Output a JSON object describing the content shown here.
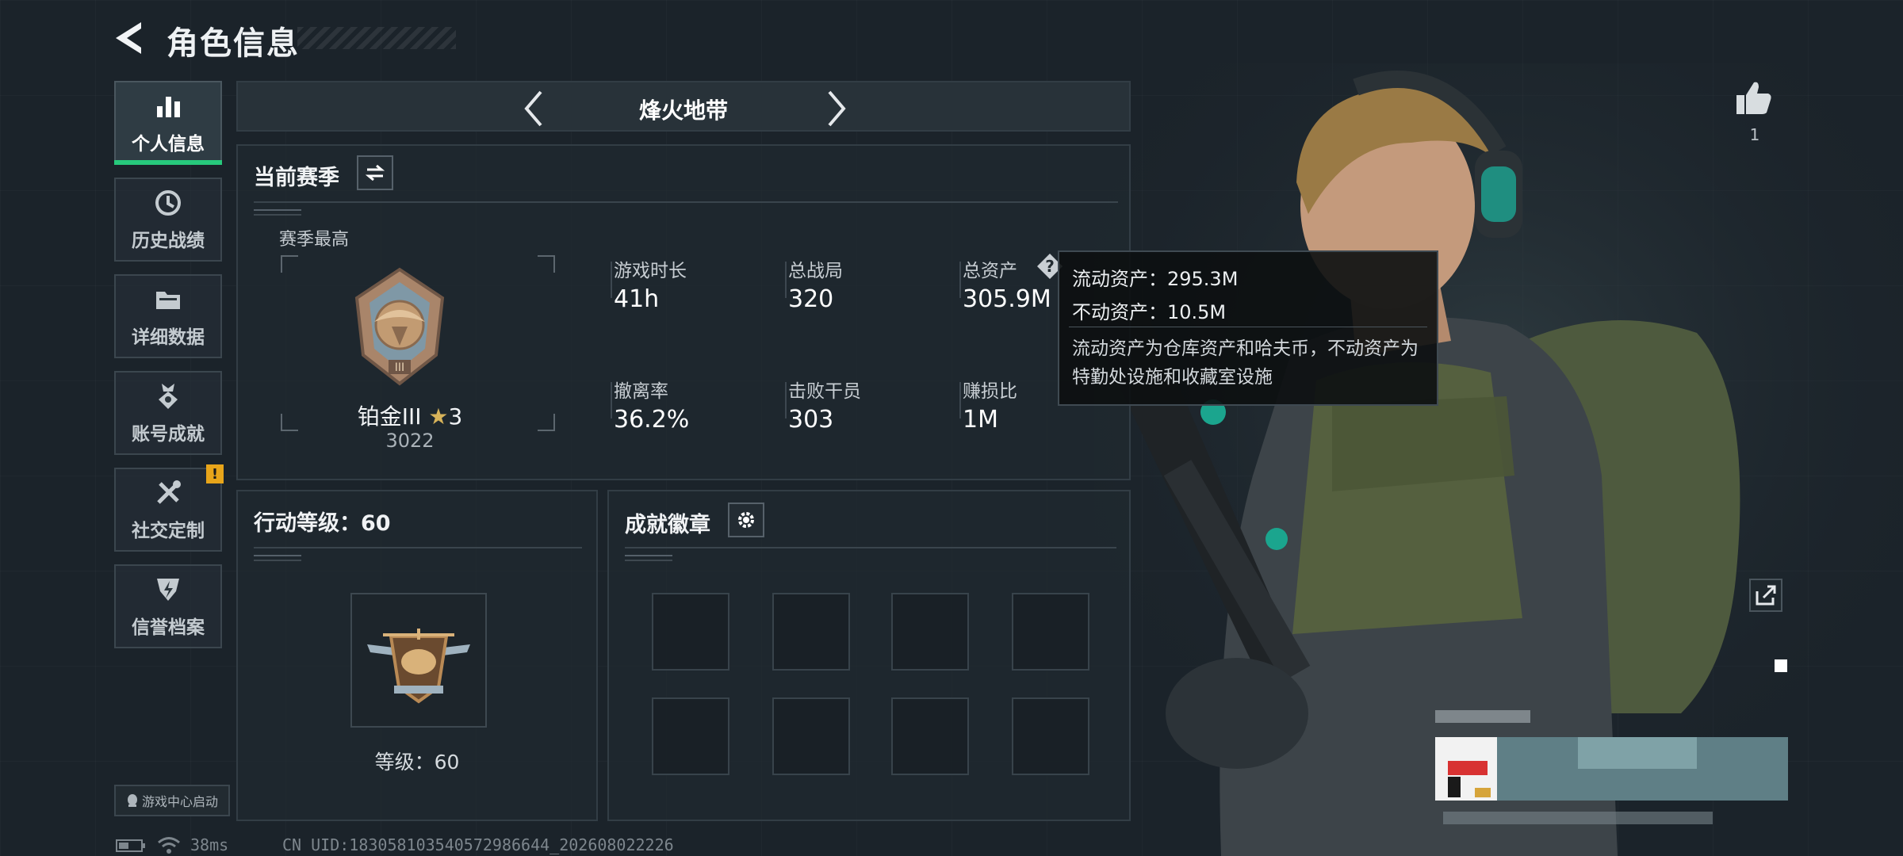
{
  "header": {
    "title": "角色信息"
  },
  "sidebar": {
    "items": [
      {
        "label": "个人信息",
        "icon": "bar-chart-icon",
        "active": true
      },
      {
        "label": "历史战绩",
        "icon": "history-clock-icon"
      },
      {
        "label": "详细数据",
        "icon": "folder-icon"
      },
      {
        "label": "账号成就",
        "icon": "medal-icon"
      },
      {
        "label": "社交定制",
        "icon": "tools-icon",
        "badge": "!"
      },
      {
        "label": "信誉档案",
        "icon": "credit-shield-icon"
      }
    ],
    "launch_label": "游戏中心启动"
  },
  "mode": {
    "title": "烽火地带"
  },
  "season": {
    "title": "当前赛季",
    "best_label": "赛季最高",
    "rank_name": "铂金III",
    "rank_stars": "3",
    "rank_points": "3022",
    "stats": [
      {
        "label": "游戏时长",
        "value": "41h"
      },
      {
        "label": "总战局",
        "value": "320"
      },
      {
        "label": "总资产",
        "value": "305.9M"
      },
      {
        "label": "撤离率",
        "value": "36.2%"
      },
      {
        "label": "击败干员",
        "value": "303"
      },
      {
        "label": "赚损比",
        "value": "1M"
      }
    ]
  },
  "tooltip": {
    "liquid": "流动资产：295.3M",
    "fixed": "不动资产：10.5M",
    "desc": "流动资产为仓库资产和哈夫币，不动资产为特勤处设施和收藏室设施"
  },
  "action_level": {
    "title": "行动等级：60",
    "level_text": "等级：60"
  },
  "achievements": {
    "title": "成就徽章"
  },
  "footer": {
    "latency": "38ms",
    "uid": "CN UID:1830581035405729866​44_202608022226"
  },
  "likes": {
    "count": "1"
  },
  "colors": {
    "accent_green": "#27c97c",
    "badge_yellow": "#e8a51a",
    "background": "#1b232a"
  }
}
